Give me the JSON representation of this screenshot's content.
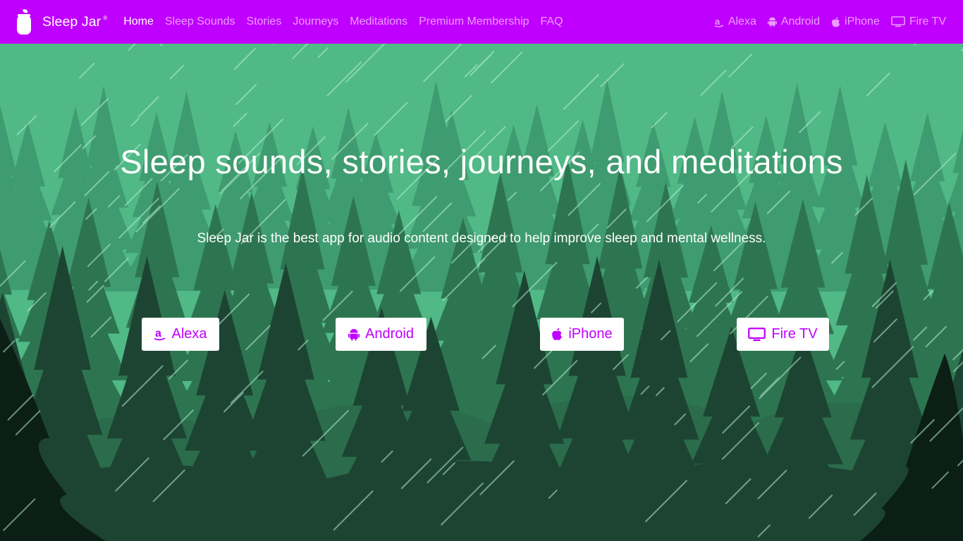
{
  "brand": {
    "name": "Sleep Jar",
    "reg": "®"
  },
  "nav": {
    "links": [
      "Home",
      "Sleep Sounds",
      "Stories",
      "Journeys",
      "Meditations",
      "Premium Membership",
      "FAQ"
    ],
    "active": "Home",
    "platforms": [
      {
        "label": "Alexa",
        "icon": "amazon-icon"
      },
      {
        "label": "Android",
        "icon": "android-icon"
      },
      {
        "label": "iPhone",
        "icon": "apple-icon"
      },
      {
        "label": "Fire TV",
        "icon": "tv-icon"
      }
    ]
  },
  "hero": {
    "title": "Sleep sounds, stories, journeys, and meditations",
    "subtitle": "Sleep Jar is the best app for audio content designed to help improve sleep and mental wellness.",
    "buttons": [
      {
        "label": "Alexa",
        "icon": "amazon-icon"
      },
      {
        "label": "Android",
        "icon": "android-icon"
      },
      {
        "label": "iPhone",
        "icon": "apple-icon"
      },
      {
        "label": "Fire TV",
        "icon": "tv-icon"
      }
    ]
  },
  "colors": {
    "brand": "#c000ff",
    "nav_inactive": "#ed9bff",
    "sky": "#50b986",
    "forest_far": "#3f9c70",
    "forest_mid": "#2d7550",
    "forest_near": "#1d4433",
    "forest_dark": "#0b1f17",
    "rain": "#b6f0d2"
  }
}
